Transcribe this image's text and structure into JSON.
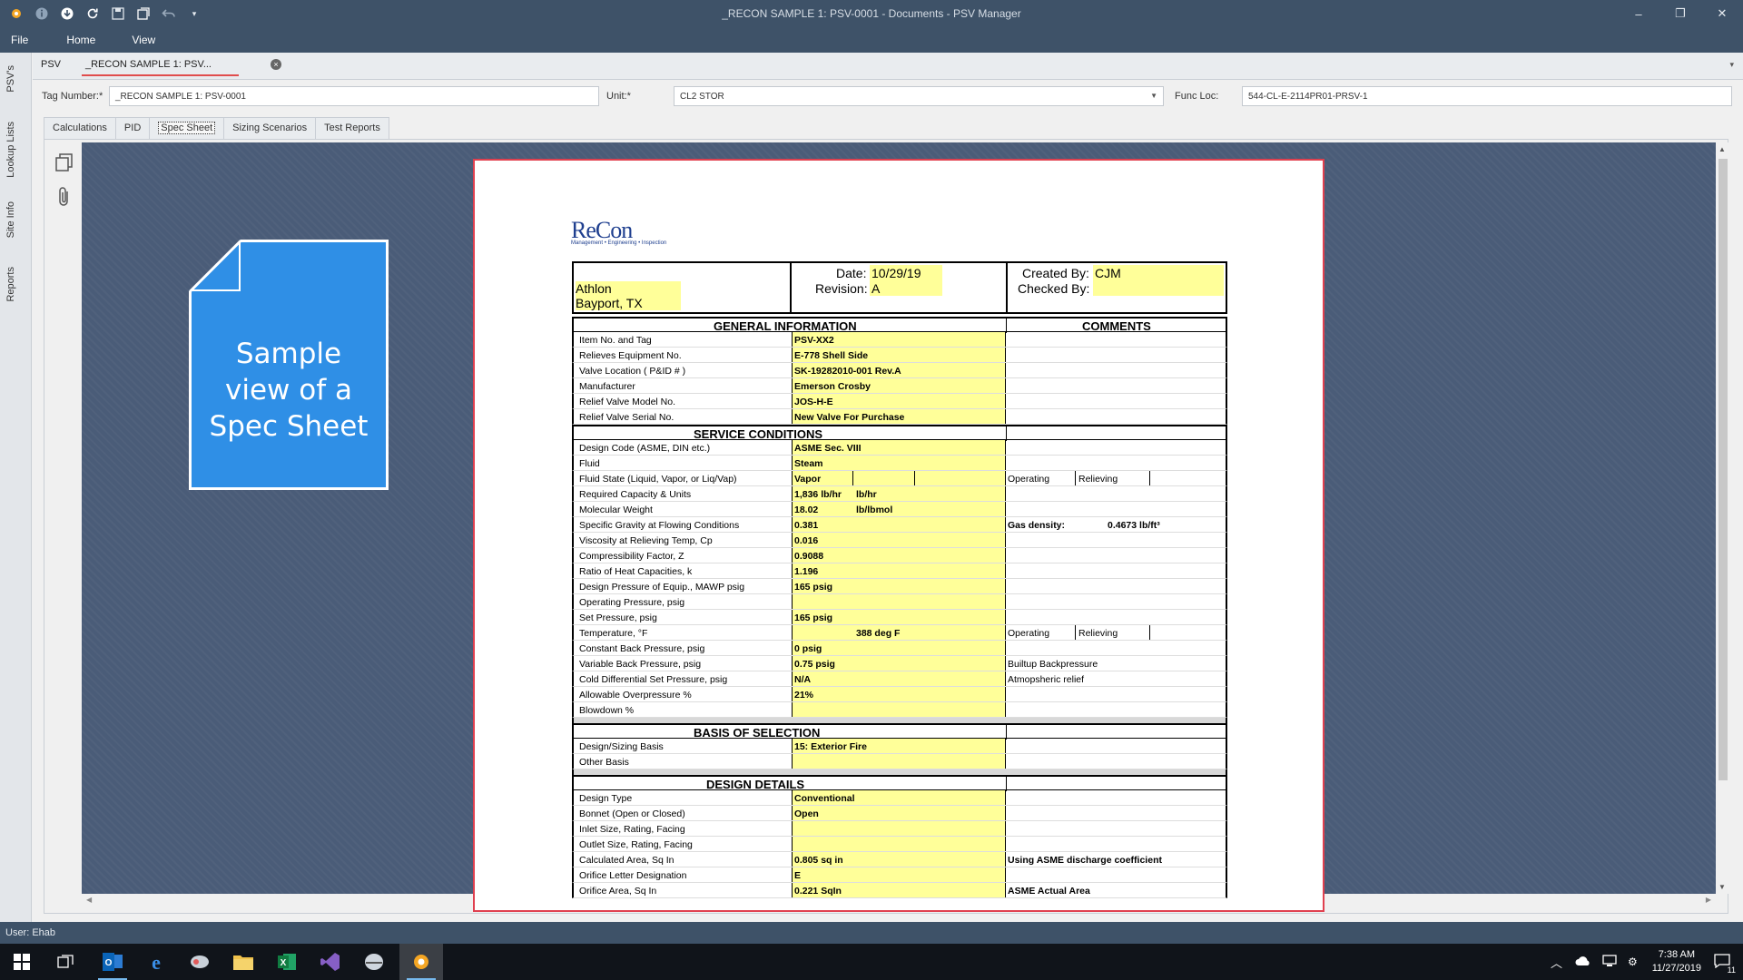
{
  "window": {
    "title": "_RECON SAMPLE 1: PSV-0001 - Documents - PSV Manager",
    "quick_access_icons": [
      "app-logo-icon",
      "info-icon",
      "download-icon",
      "refresh-icon",
      "save-icon",
      "layout-icon",
      "undo-icon",
      "dropdown-icon"
    ]
  },
  "menu": {
    "items": [
      "File",
      "Home",
      "View"
    ]
  },
  "left_rail": {
    "items": [
      "PSV's",
      "Lookup Lists",
      "Site Info",
      "Reports"
    ]
  },
  "doc_tabs": {
    "items": [
      "PSV",
      "_RECON SAMPLE 1: PSV..."
    ],
    "close": "×"
  },
  "fields": {
    "tag_label": "Tag Number:*",
    "tag_value": "_RECON SAMPLE 1: PSV-0001",
    "unit_label": "Unit:*",
    "unit_value": "CL2 STOR",
    "funcloc_label": "Func Loc:",
    "funcloc_value": "544-CL-E-2114PR01-PRSV-1"
  },
  "sub_tabs": {
    "items": [
      "Calculations",
      "PID",
      "Spec Sheet",
      "Sizing Scenarios",
      "Test Reports"
    ],
    "active": "Spec Sheet"
  },
  "callout": {
    "text": "Sample view of a Spec Sheet"
  },
  "sheet": {
    "logo": {
      "name": "ReCon",
      "tagline": "Management • Engineering • Inspection"
    },
    "header": {
      "company": "Athlon",
      "location": "Bayport, TX",
      "date_label": "Date:",
      "date": "10/29/19",
      "revision_label": "Revision:",
      "revision": "A",
      "created_label": "Created By:",
      "created": "CJM",
      "checked_label": "Checked By:",
      "checked": ""
    },
    "general": {
      "title": "GENERAL INFORMATION",
      "comments_title": "COMMENTS",
      "rows": [
        {
          "label": "Item No. and Tag",
          "value": "PSV-XX2"
        },
        {
          "label": "Relieves Equipment No.",
          "value": "E-778 Shell Side"
        },
        {
          "label": "Valve Location ( P&ID # )",
          "value": "SK-19282010-001  Rev.A"
        },
        {
          "label": "Manufacturer",
          "value": "Emerson Crosby"
        },
        {
          "label": "Relief Valve Model No.",
          "value": "JOS-H-E"
        },
        {
          "label": "Relief Valve Serial No.",
          "value": "New Valve For Purchase"
        }
      ]
    },
    "service": {
      "title": "SERVICE CONDITIONS",
      "rows": [
        {
          "label": "Design Code (ASME, DIN etc.)",
          "value": "ASME Sec. VIII",
          "value2": "",
          "comment": "",
          "comment2": ""
        },
        {
          "label": "Fluid",
          "value": "Steam",
          "value2": "",
          "comment": "",
          "comment2": ""
        },
        {
          "label": "Fluid State (Liquid, Vapor, or  Liq/Vap)",
          "value": "Vapor",
          "value2": "",
          "comment": "Operating",
          "comment2": "Relieving"
        },
        {
          "label": "Required Capacity & Units",
          "value": "1,836 lb/hr",
          "value2": "lb/hr",
          "comment": "",
          "comment2": ""
        },
        {
          "label": "Molecular Weight",
          "value": "18.02",
          "value2": "lb/lbmol",
          "comment": "",
          "comment2": ""
        },
        {
          "label": "Specific Gravity at Flowing Conditions",
          "value": "0.381",
          "value2": "",
          "comment": "Gas density:",
          "comment2": "0.4673  lb/ft³"
        },
        {
          "label": "Viscosity at Relieving Temp, Cp",
          "value": "0.016",
          "value2": "",
          "comment": "",
          "comment2": ""
        },
        {
          "label": "Compressibility Factor, Z",
          "value": "0.9088",
          "value2": "",
          "comment": "",
          "comment2": ""
        },
        {
          "label": "Ratio of Heat Capacities, k",
          "value": "1.196",
          "value2": "",
          "comment": "",
          "comment2": ""
        },
        {
          "label": "Design Pressure of Equip., MAWP psig",
          "value": "165 psig",
          "value2": "",
          "comment": "",
          "comment2": ""
        },
        {
          "label": "Operating Pressure,  psig",
          "value": "",
          "value2": "",
          "comment": "",
          "comment2": ""
        },
        {
          "label": "Set Pressure,  psig",
          "value": "165 psig",
          "value2": "",
          "comment": "",
          "comment2": ""
        },
        {
          "label": "Temperature, °F",
          "value": "",
          "value2": "388  deg F",
          "comment": "Operating",
          "comment2": "Relieving"
        },
        {
          "label": "Constant Back Pressure, psig",
          "value": "0 psig",
          "value2": "",
          "comment": "",
          "comment2": ""
        },
        {
          "label": "Variable Back Pressure, psig",
          "value": "0.75 psig",
          "value2": "",
          "comment": "Builtup Backpressure",
          "comment2": ""
        },
        {
          "label": "Cold Differential Set Pressure, psig",
          "value": "N/A",
          "value2": "",
          "comment": "Atmopsheric relief",
          "comment2": ""
        },
        {
          "label": "Allowable Overpressure %",
          "value": "21%",
          "value2": "",
          "comment": "",
          "comment2": ""
        },
        {
          "label": "Blowdown %",
          "value": "",
          "value2": "",
          "comment": "",
          "comment2": ""
        }
      ]
    },
    "basis": {
      "title": "BASIS OF SELECTION",
      "rows": [
        {
          "label": "Design/Sizing Basis",
          "value": "15: Exterior Fire"
        },
        {
          "label": "Other Basis",
          "value": ""
        }
      ]
    },
    "design": {
      "title": "DESIGN DETAILS",
      "rows": [
        {
          "label": "Design Type",
          "value": "Conventional",
          "comment": ""
        },
        {
          "label": "Bonnet (Open or Closed)",
          "value": "Open",
          "comment": ""
        },
        {
          "label": "Inlet Size, Rating, Facing",
          "value": "",
          "comment": ""
        },
        {
          "label": "Outlet Size, Rating, Facing",
          "value": "",
          "comment": ""
        },
        {
          "label": "Calculated Area, Sq In",
          "value": "0.805  sq in",
          "comment": "Using ASME discharge coefficient"
        },
        {
          "label": "Orifice Letter Designation",
          "value": "E",
          "comment": ""
        },
        {
          "label": "Orifice Area, Sq In",
          "value": "0.221  SqIn",
          "comment": "ASME Actual Area"
        }
      ]
    }
  },
  "status": {
    "user": "User: Ehab"
  },
  "taskbar": {
    "icons": [
      "windows-start-icon",
      "task-view-icon",
      "outlook-icon",
      "edge-icon",
      "snipping-icon",
      "file-explorer-icon",
      "excel-icon",
      "visual-studio-icon",
      "psv-app-icon",
      "psv-manager-icon"
    ],
    "time": "7:38 AM",
    "date": "11/27/2019",
    "notification_count": "11"
  }
}
